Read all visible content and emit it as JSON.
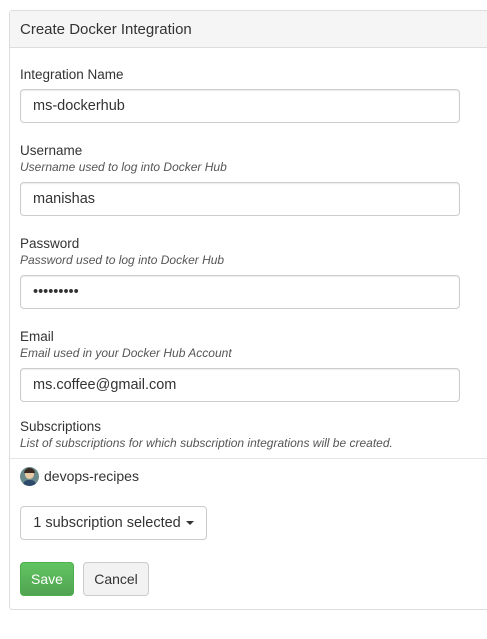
{
  "panel": {
    "title": "Create Docker Integration"
  },
  "form": {
    "integration_name": {
      "label": "Integration Name",
      "value": "ms-dockerhub"
    },
    "username": {
      "label": "Username",
      "help": "Username used to log into Docker Hub",
      "value": "manishas"
    },
    "password": {
      "label": "Password",
      "help": "Password used to log into Docker Hub",
      "value": "•••••••••"
    },
    "email": {
      "label": "Email",
      "help": "Email used in your Docker Hub Account",
      "value": "ms.coffee@gmail.com"
    },
    "subscriptions": {
      "label": "Subscriptions",
      "help": "List of subscriptions for which subscription integrations will be created.",
      "items": [
        {
          "name": "devops-recipes",
          "icon": "avatar-icon"
        }
      ],
      "dropdown_label": "1 subscription selected"
    }
  },
  "actions": {
    "save_label": "Save",
    "cancel_label": "Cancel"
  },
  "colors": {
    "save_button": "#5cb85c",
    "header_background": "#f5f5f5",
    "border": "#dddddd"
  }
}
